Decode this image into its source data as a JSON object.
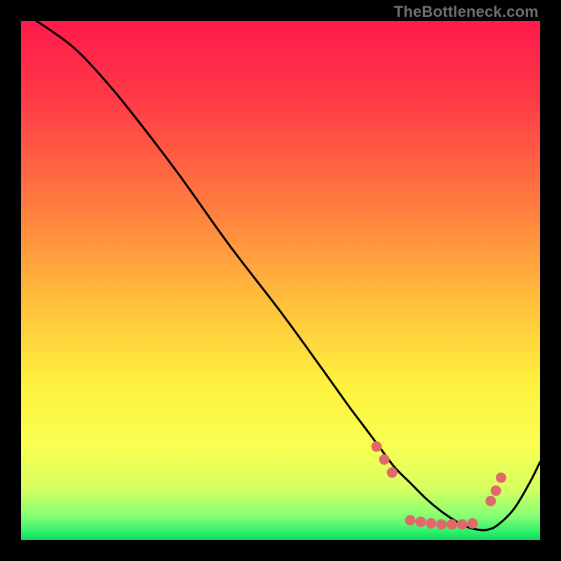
{
  "watermark": "TheBottleneck.com",
  "chart_data": {
    "type": "line",
    "title": "",
    "xlabel": "",
    "ylabel": "",
    "xlim": [
      0,
      100
    ],
    "ylim": [
      0,
      100
    ],
    "grid": false,
    "legend": null,
    "background": {
      "type": "vertical-gradient",
      "stops": [
        {
          "pos": 0.0,
          "color": "#ff1a4b"
        },
        {
          "pos": 0.15,
          "color": "#ff3a47"
        },
        {
          "pos": 0.35,
          "color": "#ff7a3f"
        },
        {
          "pos": 0.55,
          "color": "#ffc23c"
        },
        {
          "pos": 0.7,
          "color": "#fff13e"
        },
        {
          "pos": 0.82,
          "color": "#f8ff52"
        },
        {
          "pos": 0.9,
          "color": "#d7ff60"
        },
        {
          "pos": 0.955,
          "color": "#84ff74"
        },
        {
          "pos": 0.985,
          "color": "#2bf06b"
        },
        {
          "pos": 1.0,
          "color": "#0fd95f"
        }
      ]
    },
    "series": [
      {
        "name": "bottleneck-curve",
        "color": "#000000",
        "x": [
          3,
          6,
          10,
          14,
          20,
          30,
          40,
          50,
          58,
          63,
          66,
          69,
          72,
          75,
          78,
          81,
          84,
          86,
          88,
          90,
          92,
          95,
          98,
          100
        ],
        "y": [
          100,
          98,
          95,
          91,
          84,
          71,
          57,
          44,
          33,
          26,
          22,
          18,
          14,
          11,
          8,
          5.5,
          3.5,
          2.5,
          2,
          2,
          3,
          6,
          11,
          15
        ]
      }
    ],
    "markers": {
      "name": "highlight-dots",
      "color": "#e06a6a",
      "radius": 7.5,
      "points": [
        {
          "x": 68.5,
          "y": 18
        },
        {
          "x": 70.0,
          "y": 15.5
        },
        {
          "x": 71.5,
          "y": 13
        },
        {
          "x": 75.0,
          "y": 3.8
        },
        {
          "x": 77.0,
          "y": 3.5
        },
        {
          "x": 79.0,
          "y": 3.2
        },
        {
          "x": 81.0,
          "y": 3.0
        },
        {
          "x": 83.0,
          "y": 3.0
        },
        {
          "x": 85.0,
          "y": 3.0
        },
        {
          "x": 87.0,
          "y": 3.2
        },
        {
          "x": 90.5,
          "y": 7.5
        },
        {
          "x": 91.5,
          "y": 9.5
        },
        {
          "x": 92.5,
          "y": 12.0
        }
      ]
    }
  }
}
